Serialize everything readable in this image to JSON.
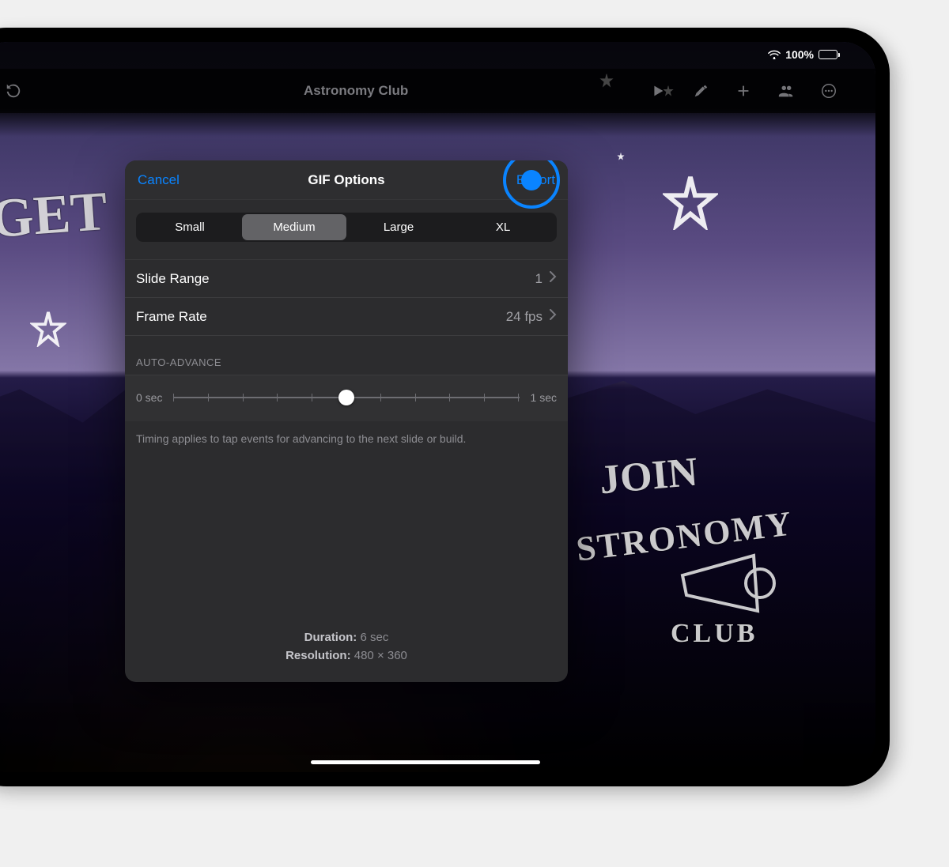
{
  "statusbar": {
    "battery_pct": "100%"
  },
  "toolbar": {
    "title": "Astronomy Club"
  },
  "wallpaper": {
    "text_left": "GET",
    "text_right_line1": "JOIN",
    "text_right_line2": "STRONOMY",
    "text_right_line3": "CLUB"
  },
  "modal": {
    "cancel": "Cancel",
    "title": "GIF Options",
    "export": "Export",
    "size": {
      "options": [
        "Small",
        "Medium",
        "Large",
        "XL"
      ],
      "selected_index": 1
    },
    "rows": {
      "slide_range": {
        "label": "Slide Range",
        "value": "1"
      },
      "frame_rate": {
        "label": "Frame Rate",
        "value": "24 fps"
      }
    },
    "auto_advance": {
      "header": "AUTO-ADVANCE",
      "min_label": "0 sec",
      "max_label": "1 sec",
      "ticks": 10,
      "position_pct": 50,
      "footnote": "Timing applies to tap events for advancing to the next slide or build."
    },
    "meta": {
      "duration_label": "Duration:",
      "duration_value": "6 sec",
      "resolution_label": "Resolution:",
      "resolution_value": "480 × 360"
    }
  }
}
